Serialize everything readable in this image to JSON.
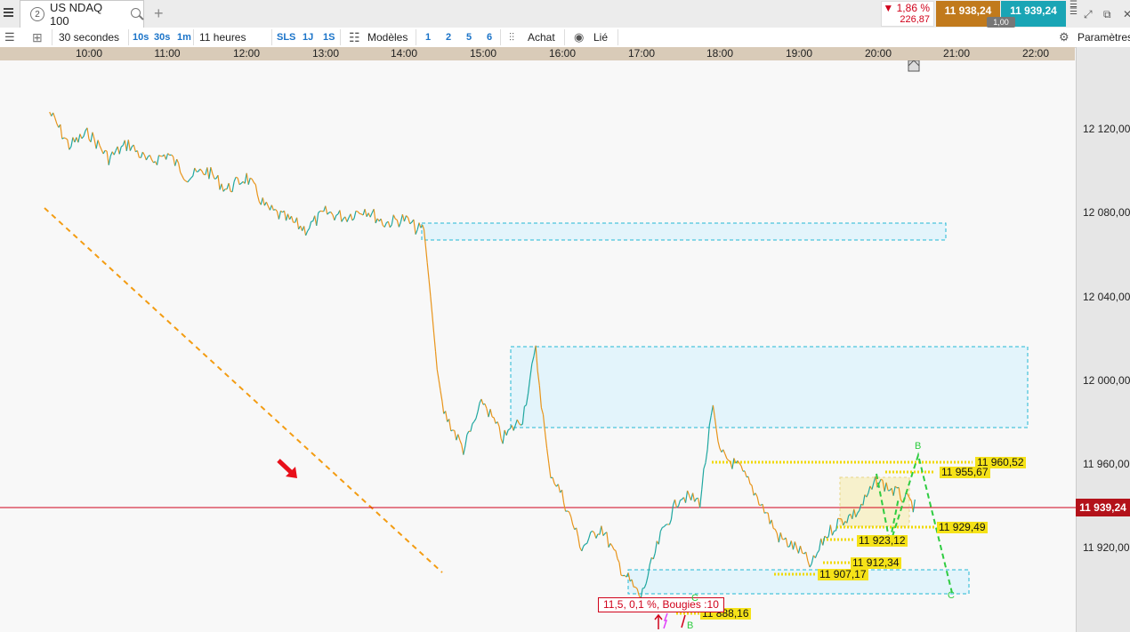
{
  "header": {
    "tab_number": "2",
    "instrument": "US NDAQ 100",
    "change_pct": "▼ 1,86 %",
    "change_abs": "226,87",
    "bid": "11 938,24",
    "ask": "11 939,24",
    "spread": "1,00"
  },
  "toolbar": {
    "interval": "30 secondes",
    "btn_10s": "10s",
    "btn_30s": "30s",
    "btn_1m": "1m",
    "period": "11 heures",
    "btn_sls": "SLS",
    "btn_1j": "1J",
    "btn_1s": "1S",
    "models": "Modèles",
    "n1": "1",
    "n2": "2",
    "n5": "5",
    "n6": "6",
    "buy": "Achat",
    "linked": "Lié",
    "settings": "Paramètres"
  },
  "chart_data": {
    "type": "line",
    "instrument": "US NDAQ 100",
    "x_ticks": [
      "10:00",
      "11:00",
      "12:00",
      "13:00",
      "14:00",
      "15:00",
      "16:00",
      "17:00",
      "18:00",
      "19:00",
      "20:00",
      "21:00",
      "22:00"
    ],
    "y_ticks": [
      "12 120,00",
      "12 080,00",
      "12 040,00",
      "12 000,00",
      "11 960,00",
      "11 920,00"
    ],
    "ylim": [
      11872,
      12141
    ],
    "current_price": "11 939,24",
    "levels": [
      {
        "label": "11 960,52",
        "value": 11960.52
      },
      {
        "label": "11 955,67",
        "value": 11955.67
      },
      {
        "label": "11 929,49",
        "value": 11929.49
      },
      {
        "label": "11 923,12",
        "value": 11923.12
      },
      {
        "label": "11 912,34",
        "value": 11912.34
      },
      {
        "label": "11 907,17",
        "value": 11907.17
      },
      {
        "label": "11 888,16",
        "value": 11888.16
      }
    ],
    "annotation": "11,5, 0,1 %, Bougies :10",
    "wave_points": [
      "B",
      "C",
      "B",
      "C"
    ],
    "price_path": [
      [
        "09:30",
        12128
      ],
      [
        "09:45",
        12112
      ],
      [
        "10:00",
        12118
      ],
      [
        "10:15",
        12106
      ],
      [
        "10:30",
        12113
      ],
      [
        "10:45",
        12104
      ],
      [
        "11:00",
        12108
      ],
      [
        "11:15",
        12097
      ],
      [
        "11:30",
        12100
      ],
      [
        "11:45",
        12091
      ],
      [
        "12:00",
        12097
      ],
      [
        "12:15",
        12082
      ],
      [
        "12:30",
        12077
      ],
      [
        "12:45",
        12072
      ],
      [
        "13:00",
        12080
      ],
      [
        "13:15",
        12078
      ],
      [
        "13:30",
        12082
      ],
      [
        "13:45",
        12075
      ],
      [
        "14:00",
        12077
      ],
      [
        "14:10",
        12072
      ],
      [
        "14:15",
        12072
      ],
      [
        "14:20",
        12040
      ],
      [
        "14:25",
        12005
      ],
      [
        "14:30",
        11985
      ],
      [
        "14:45",
        11967
      ],
      [
        "15:00",
        11990
      ],
      [
        "15:15",
        11972
      ],
      [
        "15:30",
        11982
      ],
      [
        "15:40",
        12014
      ],
      [
        "15:50",
        11958
      ],
      [
        "16:00",
        11945
      ],
      [
        "16:15",
        11920
      ],
      [
        "16:30",
        11930
      ],
      [
        "16:45",
        11910
      ],
      [
        "17:00",
        11896
      ],
      [
        "17:15",
        11925
      ],
      [
        "17:30",
        11945
      ],
      [
        "17:45",
        11942
      ],
      [
        "17:55",
        11988
      ],
      [
        "18:00",
        11965
      ],
      [
        "18:15",
        11958
      ],
      [
        "18:30",
        11943
      ],
      [
        "18:45",
        11925
      ],
      [
        "19:00",
        11919
      ],
      [
        "19:10",
        11911
      ],
      [
        "19:20",
        11925
      ],
      [
        "19:30",
        11932
      ],
      [
        "19:45",
        11937
      ],
      [
        "20:00",
        11952
      ],
      [
        "20:15",
        11946
      ],
      [
        "20:30",
        11939
      ]
    ]
  }
}
